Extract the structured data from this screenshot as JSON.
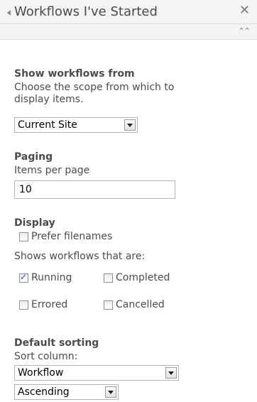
{
  "header": {
    "title": "Workflows I've Started",
    "close_glyph": "✕",
    "collapse_glyph": "⌃⌃"
  },
  "scope": {
    "title": "Show workflows from",
    "description_line1": "Choose the scope from which to",
    "description_line2": "display items.",
    "selected": "Current Site"
  },
  "paging": {
    "title": "Paging",
    "label": "Items per page",
    "value": "10"
  },
  "display": {
    "title": "Display",
    "prefer_filenames": {
      "label": "Prefer filenames",
      "checked": false
    },
    "shows_label": "Shows workflows that are:",
    "statuses": [
      {
        "label": "Running",
        "checked": true
      },
      {
        "label": "Completed",
        "checked": false
      },
      {
        "label": "Errored",
        "checked": false
      },
      {
        "label": "Cancelled",
        "checked": false
      }
    ]
  },
  "sorting": {
    "title": "Default sorting",
    "label": "Sort column:",
    "column": "Workflow",
    "order": "Ascending"
  }
}
